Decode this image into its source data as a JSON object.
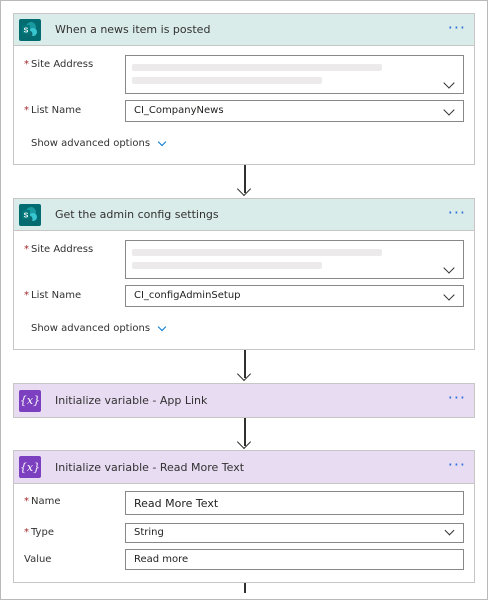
{
  "cards": {
    "trigger": {
      "title": "When a news item is posted",
      "icon": "sharepoint-icon",
      "site_address_label": "Site Address",
      "list_name_label": "List Name",
      "list_name_value": "CI_CompanyNews",
      "advanced": "Show advanced options"
    },
    "admin": {
      "title": "Get the admin config settings",
      "icon": "sharepoint-icon",
      "site_address_label": "Site Address",
      "list_name_label": "List Name",
      "list_name_value": "CI_configAdminSetup",
      "advanced": "Show advanced options"
    },
    "applink": {
      "title": "Initialize variable - App Link",
      "icon": "variable-icon",
      "icon_text": "{x}"
    },
    "readmore": {
      "title": "Initialize variable - Read More Text",
      "icon": "variable-icon",
      "icon_text": "{x}",
      "name_label": "Name",
      "name_value": "Read More Text",
      "type_label": "Type",
      "type_value": "String",
      "value_label": "Value",
      "value_value": "Read more"
    }
  },
  "more_glyph": "···",
  "colors": {
    "sharepoint_header": "#d9ecea",
    "sharepoint_icon": "#036c70",
    "variable_header": "#e8dcf3",
    "variable_icon": "#7b3fbf",
    "link_blue": "#0078d4"
  }
}
